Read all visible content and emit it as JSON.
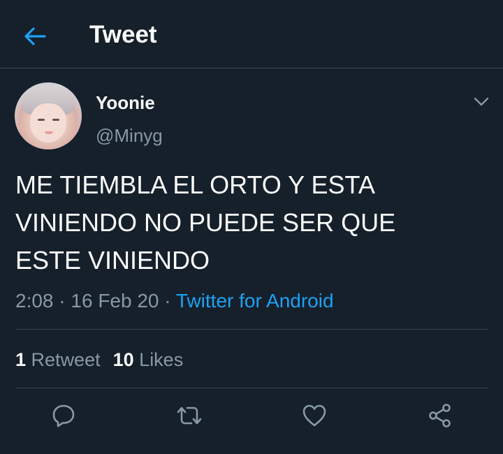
{
  "header": {
    "title": "Tweet",
    "back_icon": "arrow-left-icon"
  },
  "tweet": {
    "author": {
      "display_name": "Yoonie",
      "handle": "@Minyg"
    },
    "text": "ME TIEMBLA EL ORTO Y ESTA\nVINIENDO NO PUEDE SER QUE\nESTE VINIENDO",
    "time": "2:08",
    "separator": "·",
    "date": "16 Feb 20",
    "source": "Twitter for Android",
    "retweets": {
      "count": "1",
      "label": "Retweet"
    },
    "likes": {
      "count": "10",
      "label": "Likes"
    }
  },
  "actions": [
    {
      "icon": "reply-icon"
    },
    {
      "icon": "retweet-icon"
    },
    {
      "icon": "heart-icon"
    },
    {
      "icon": "share-icon"
    }
  ],
  "colors": {
    "background": "#15202b",
    "accent": "#1da1f2",
    "secondary_text": "#8899a6",
    "divider": "#38444d"
  }
}
